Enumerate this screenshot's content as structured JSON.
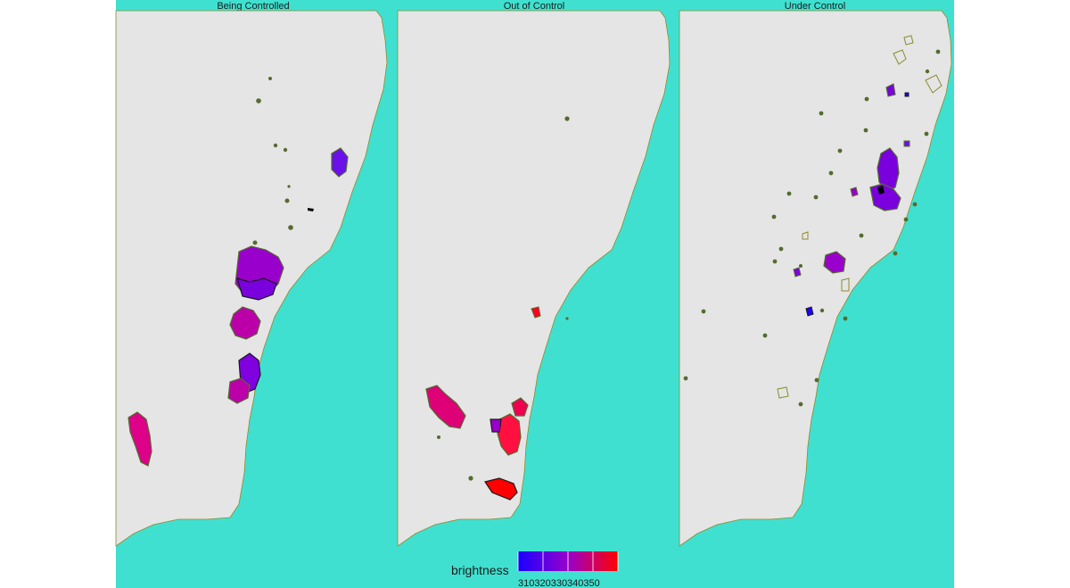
{
  "panels": [
    {
      "id": "being-controlled",
      "title": "Being Controlled"
    },
    {
      "id": "out-of-control",
      "title": "Out of Control"
    },
    {
      "id": "under-control",
      "title": "Under Control"
    }
  ],
  "legend": {
    "title": "brightness",
    "ticks": "310320330340350",
    "scale": {
      "min": 310,
      "max": 350,
      "low_color": "#1a00ff",
      "high_color": "#ff0000"
    }
  },
  "colors": {
    "ocean": "#40e0d0",
    "land": "#e5e5e5",
    "coast": "#8b8b2e",
    "fire_outline": "#556b2f",
    "hotspot": "#556b2f"
  }
}
